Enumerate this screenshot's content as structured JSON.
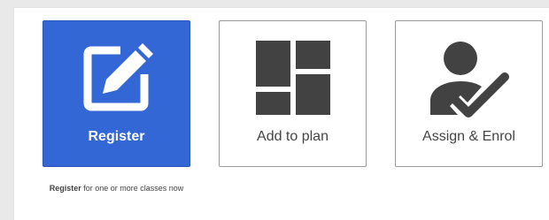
{
  "tiles": [
    {
      "label": "Register",
      "icon": "edit-square-icon",
      "active": true
    },
    {
      "label": "Add to plan",
      "icon": "dashboard-layout-icon",
      "active": false
    },
    {
      "label": "Assign & Enrol",
      "icon": "person-check-icon",
      "active": false
    }
  ],
  "register_caption": {
    "bold": "Register",
    "rest": " for one or more classes now"
  },
  "colors": {
    "active_tile": "#3367d6",
    "icon_dark": "#424242",
    "tile_border": "#9a9a9a"
  }
}
